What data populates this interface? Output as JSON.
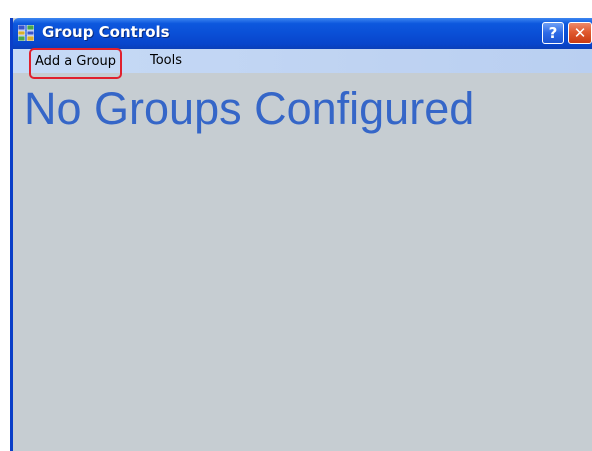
{
  "window": {
    "title": "Group Controls",
    "icon": "group-controls-app-icon",
    "help_button_label": "?",
    "close_button_label": "✕",
    "titlebar_color": "#0a4fd6",
    "background_color": "#c6cdd2"
  },
  "menu": {
    "items": [
      {
        "label": "Add a Group",
        "highlighted": true,
        "highlight_color": "#e0202e"
      },
      {
        "label": "Tools"
      }
    ]
  },
  "main": {
    "status_message": "No Groups Configured",
    "status_color": "#3566c8"
  }
}
